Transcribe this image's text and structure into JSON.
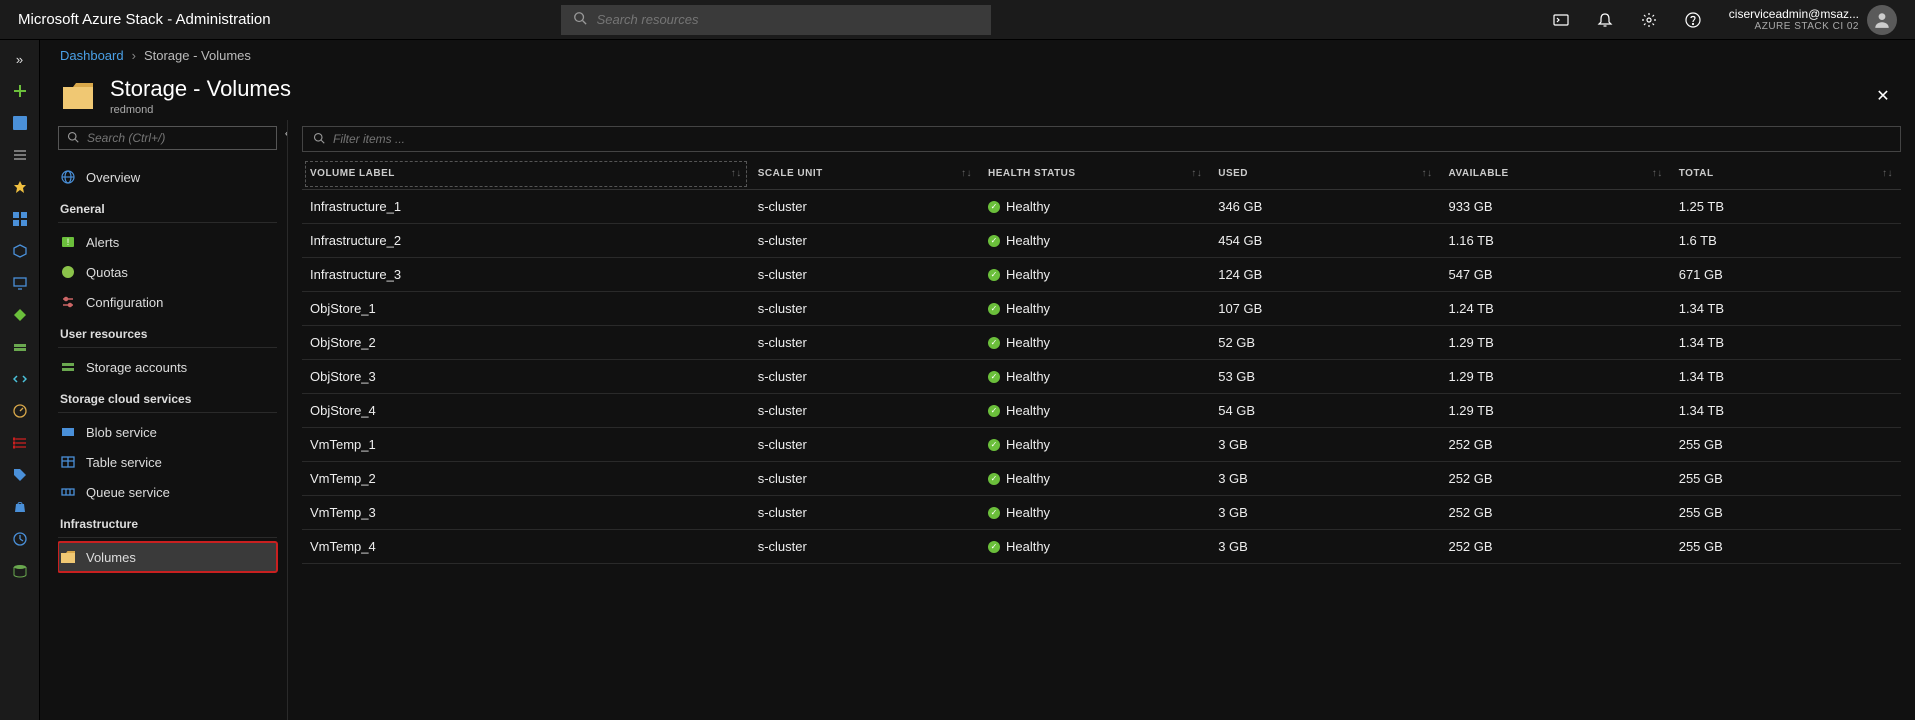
{
  "topbar": {
    "title": "Microsoft Azure Stack - Administration",
    "search_placeholder": "Search resources",
    "user_email": "ciserviceadmin@msaz...",
    "tenant": "AZURE STACK CI 02"
  },
  "breadcrumb": {
    "root": "Dashboard",
    "current": "Storage - Volumes"
  },
  "blade": {
    "title": "Storage - Volumes",
    "subtitle": "redmond",
    "nav_search_placeholder": "Search (Ctrl+/)",
    "filter_placeholder": "Filter items ..."
  },
  "nav": {
    "overview": "Overview",
    "groups": [
      {
        "title": "General",
        "items": [
          {
            "label": "Alerts",
            "icon": "alerts",
            "color": "#6bbf3b"
          },
          {
            "label": "Quotas",
            "icon": "quotas",
            "color": "#8bc34a"
          },
          {
            "label": "Configuration",
            "icon": "config",
            "color": "#c66"
          }
        ]
      },
      {
        "title": "User resources",
        "items": [
          {
            "label": "Storage accounts",
            "icon": "storage",
            "color": "#6aa84f"
          }
        ]
      },
      {
        "title": "Storage cloud services",
        "items": [
          {
            "label": "Blob service",
            "icon": "blob",
            "color": "#4a90d9"
          },
          {
            "label": "Table service",
            "icon": "table",
            "color": "#4a90d9"
          },
          {
            "label": "Queue service",
            "icon": "queue",
            "color": "#4a90d9"
          }
        ]
      },
      {
        "title": "Infrastructure",
        "items": [
          {
            "label": "Volumes",
            "icon": "folder",
            "color": "#d9a84a",
            "active": true
          }
        ]
      }
    ]
  },
  "table": {
    "columns": [
      {
        "key": "label",
        "header": "VOLUME LABEL",
        "active": true
      },
      {
        "key": "scale",
        "header": "SCALE UNIT"
      },
      {
        "key": "health",
        "header": "HEALTH STATUS"
      },
      {
        "key": "used",
        "header": "USED"
      },
      {
        "key": "avail",
        "header": "AVAILABLE"
      },
      {
        "key": "total",
        "header": "TOTAL"
      }
    ],
    "rows": [
      {
        "label": "Infrastructure_1",
        "scale": "s-cluster",
        "health": "Healthy",
        "used": "346 GB",
        "avail": "933 GB",
        "total": "1.25 TB"
      },
      {
        "label": "Infrastructure_2",
        "scale": "s-cluster",
        "health": "Healthy",
        "used": "454 GB",
        "avail": "1.16 TB",
        "total": "1.6 TB"
      },
      {
        "label": "Infrastructure_3",
        "scale": "s-cluster",
        "health": "Healthy",
        "used": "124 GB",
        "avail": "547 GB",
        "total": "671 GB"
      },
      {
        "label": "ObjStore_1",
        "scale": "s-cluster",
        "health": "Healthy",
        "used": "107 GB",
        "avail": "1.24 TB",
        "total": "1.34 TB"
      },
      {
        "label": "ObjStore_2",
        "scale": "s-cluster",
        "health": "Healthy",
        "used": "52 GB",
        "avail": "1.29 TB",
        "total": "1.34 TB"
      },
      {
        "label": "ObjStore_3",
        "scale": "s-cluster",
        "health": "Healthy",
        "used": "53 GB",
        "avail": "1.29 TB",
        "total": "1.34 TB"
      },
      {
        "label": "ObjStore_4",
        "scale": "s-cluster",
        "health": "Healthy",
        "used": "54 GB",
        "avail": "1.29 TB",
        "total": "1.34 TB"
      },
      {
        "label": "VmTemp_1",
        "scale": "s-cluster",
        "health": "Healthy",
        "used": "3 GB",
        "avail": "252 GB",
        "total": "255 GB"
      },
      {
        "label": "VmTemp_2",
        "scale": "s-cluster",
        "health": "Healthy",
        "used": "3 GB",
        "avail": "252 GB",
        "total": "255 GB"
      },
      {
        "label": "VmTemp_3",
        "scale": "s-cluster",
        "health": "Healthy",
        "used": "3 GB",
        "avail": "252 GB",
        "total": "255 GB"
      },
      {
        "label": "VmTemp_4",
        "scale": "s-cluster",
        "health": "Healthy",
        "used": "3 GB",
        "avail": "252 GB",
        "total": "255 GB"
      }
    ]
  }
}
